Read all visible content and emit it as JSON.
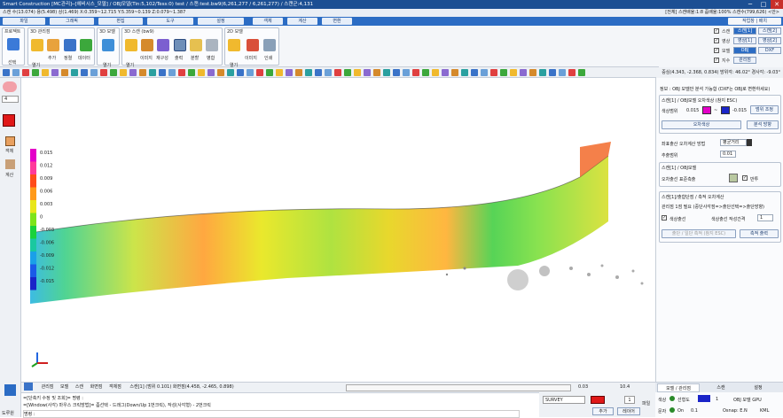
{
  "titlebar": {
    "text": "Smart Construction [MC관리]─[헤비시스_모델] / OBJ모델(Tin:5,102/Tess:0) test / 스캔:test.bw9(6,261,277 / 6,261,277) / 스캔군:4,131",
    "minimize": "─",
    "maximize": "□",
    "close": "✕"
  },
  "statusrow": {
    "left": "스캔 수(13.074) 용(5.498) 상(1.469) X:0.359~12.715 Y:5.359~0.139 Z:0.079~1.387",
    "right": "[전체] 스캔배율:1:8  줌배율:100%  스캔수(799,626) <안>"
  },
  "menubar": {
    "items": [
      "파일",
      "그래픽",
      "편집",
      "도구",
      "설정",
      "객체",
      "계산",
      "변환"
    ],
    "right_label": "작업창 | 배치"
  },
  "ribbon": {
    "groups": [
      {
        "title": "프로젝트",
        "tools": [
          "선택"
        ]
      },
      {
        "title": "3D 관리점",
        "tools": [
          "열기",
          "추가",
          "정렬",
          "데이터"
        ]
      },
      {
        "title": "3D 모델",
        "tools": [
          "열기"
        ]
      },
      {
        "title": "3D 스캔 (bw9)",
        "tools": [
          "열기",
          "이미지",
          "재구성",
          "출력",
          "분할",
          "병합"
        ]
      },
      {
        "title": "2D 모델",
        "tools": [
          "열기",
          "이미지",
          "인쇄"
        ]
      }
    ]
  },
  "viewchecks": {
    "rows": [
      {
        "label": "스캔",
        "buttons": [
          "스캔[1]",
          "스캔[2]"
        ]
      },
      {
        "label": "영상",
        "buttons": [
          "영상[1]",
          "영상[2]"
        ]
      },
      {
        "label": "모델",
        "buttons": [
          "OBJ",
          "DXF"
        ]
      },
      {
        "label": "지수",
        "buttons": [
          "관리점"
        ]
      }
    ]
  },
  "coordbar": "중심(4.343, -2.368, 0.834)  방위각: 46.02°  경사각: -9.03°",
  "leftpanel": {
    "dropdown_value": "4",
    "object_label": "객체",
    "calc_label": "계산"
  },
  "legend": {
    "values": [
      "0.015",
      "0.012",
      "0.009",
      "0.006",
      "0.003",
      "0",
      "-0.003",
      "-0.006",
      "-0.009",
      "-0.012",
      "-0.015"
    ],
    "colors": [
      "#e400c8",
      "#ff3a9a",
      "#ff4c1a",
      "#ff9a1a",
      "#e8e61a",
      "#7de41a",
      "#1ad23c",
      "#1ac8a0",
      "#1aa0e8",
      "#1a5ae8",
      "#1a24c8"
    ]
  },
  "rightpanel": {
    "info_line": "정보 : OBJ 모델만 분석 가능합 (DXF는 OBJ로 변환하세요)",
    "section1_title": "스캔[1] / OBJ모델 오차색상 (참지 ESC)",
    "color_range_label": "색상범위",
    "color_range_min": "0.015",
    "color_range_sep": "~",
    "color_range_max": "-0.015",
    "range_adjust_btn": "범위 조정",
    "error_color_btn": "오차색상",
    "analysis_btn": "분석 방향",
    "calc_method_label": "좌표출산 오차계산 방법",
    "calc_method_value": "평균거리",
    "extract_range_label": "추출범위",
    "extract_range_value": "0.01",
    "section2_title": "스캔[1] / OBJ모델",
    "error_line_label": "오차출선 표준측출",
    "error_line_check": "반투",
    "section3_title": "스캔[1]/출합단점 / 측적 오차계산",
    "section3_desc": "관리점 1점 필요 (중단사각점=>출단선택=>출단방향)",
    "color_extract_label": "색상출선",
    "color_extract_info": "색상출선 작성간격",
    "color_extract_value": "1",
    "cancel_btn": "출단 / 일단 측적 (참지 ESC)",
    "save_btn": "측적 출력"
  },
  "bottombar1": {
    "items": [
      "관리점",
      "모델",
      "스캔",
      "화면점",
      "객체점"
    ],
    "status": "스캔[1] (범위 0.101) 화면점(4.458, -2.465, 0.898)",
    "zoom_value": "0.03",
    "scale_label": "10.4"
  },
  "cmdarea": {
    "lines": [
      "=[단축키 수정 및 조회]= 명령 :",
      "=[Window(사각) 마우스 크릭방법]= 좀선택 - 드래그(Down/Up 1번크릭), 작성(사각형) - 2번크릭",
      "명령 :"
    ]
  },
  "bottomright": {
    "survey": "SURVEY",
    "layer_value": "1",
    "add_btn": "추가",
    "layer_btn": "레이어",
    "file_label": "파일"
  },
  "rtabs": [
    "모델 / 관리점",
    "스캔",
    "설정"
  ],
  "rbottom": {
    "color_label": "색상",
    "point_label": "선형도",
    "point_value": "1",
    "obj_label": "OBJ 모델 GPU",
    "text_label": "문자",
    "on_label": "On",
    "on_value": "0.1",
    "osnap_label": "Osnap: E.N",
    "kml_label": "KML"
  },
  "leftbottom_label": "도루원"
}
